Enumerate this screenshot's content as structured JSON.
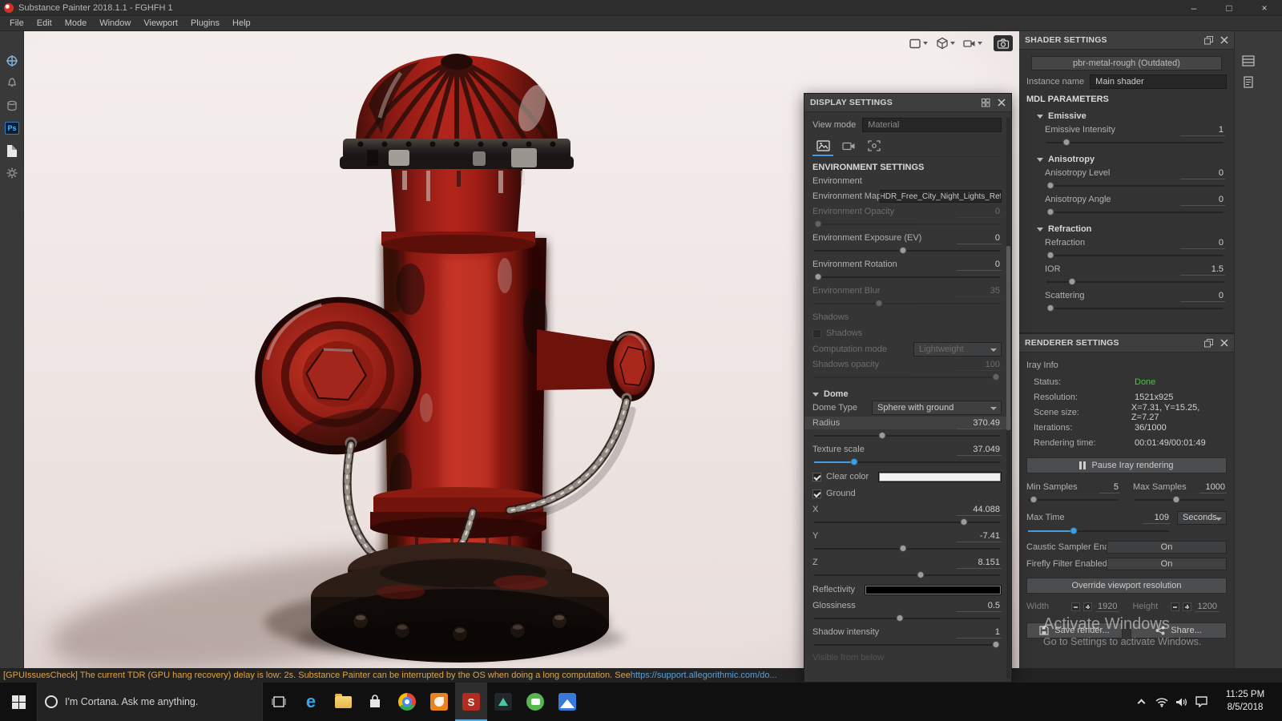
{
  "colors": {
    "accent_blue": "#3f9fdf",
    "status_done_green": "#3ecb3e",
    "warning_orange": "#dfa33d",
    "hydrant_red": "#a82017",
    "viewport_background": "#efe7e5",
    "clear_color_swatch": "#f2f2f2",
    "reflectivity_swatch": "#000000"
  },
  "icons": {
    "minimize": "–",
    "maximize": "□",
    "close": "×",
    "edge_letter": "e",
    "painter_letter": "S"
  },
  "titlebar": {
    "title": "Substance Painter 2018.1.1 - FGHFH 1"
  },
  "menubar": {
    "items": [
      "File",
      "Edit",
      "Mode",
      "Window",
      "Viewport",
      "Plugins",
      "Help"
    ]
  },
  "display_settings": {
    "title": "DISPLAY SETTINGS",
    "view_mode": {
      "label": "View mode",
      "value": "Material"
    },
    "environment_settings_header": "ENVIRONMENT SETTINGS",
    "environment_group": "Environment",
    "environment_map": {
      "label": "Environment Map",
      "value": "HDR_Free_City_Night_Lights_Ref"
    },
    "environment_opacity": {
      "label": "Environment Opacity",
      "value": "0"
    },
    "environment_exposure": {
      "label": "Environment Exposure (EV)",
      "value": "0"
    },
    "environment_rotation": {
      "label": "Environment Rotation",
      "value": "0"
    },
    "environment_blur": {
      "label": "Environment Blur",
      "value": "35"
    },
    "shadows_group": "Shadows",
    "shadows_checkbox": {
      "label": "Shadows"
    },
    "computation_mode": {
      "label": "Computation mode",
      "value": "Lightweight"
    },
    "shadows_opacity": {
      "label": "Shadows opacity",
      "value": "100"
    },
    "dome_group": "Dome",
    "dome_type": {
      "label": "Dome Type",
      "value": "Sphere with ground"
    },
    "radius": {
      "label": "Radius",
      "value": "370.49"
    },
    "texture_scale": {
      "label": "Texture scale",
      "value": "37.049"
    },
    "clear_color": {
      "label": "Clear color",
      "swatch": "#f2f2f2"
    },
    "ground": {
      "label": "Ground"
    },
    "x": {
      "label": "X",
      "value": "44.088"
    },
    "y": {
      "label": "Y",
      "value": "-7.41"
    },
    "z": {
      "label": "Z",
      "value": "8.151"
    },
    "reflectivity": {
      "label": "Reflectivity",
      "swatch": "#000000"
    },
    "glossiness": {
      "label": "Glossiness",
      "value": "0.5"
    },
    "shadow_intensity": {
      "label": "Shadow intensity",
      "value": "1"
    },
    "visible_from_below": "Visible from below"
  },
  "shader_settings": {
    "title": "SHADER SETTINGS",
    "shader_button": "pbr-metal-rough (Outdated)",
    "instance_name": {
      "label": "Instance name",
      "value": "Main shader"
    },
    "mdl_header": "MDL PARAMETERS",
    "emissive_group": "Emissive",
    "emissive_intensity": {
      "label": "Emissive Intensity",
      "value": "1"
    },
    "anisotropy_group": "Anisotropy",
    "anisotropy_level": {
      "label": "Anisotropy Level",
      "value": "0"
    },
    "anisotropy_angle": {
      "label": "Anisotropy Angle",
      "value": "0"
    },
    "refraction_group": "Refraction",
    "refraction": {
      "label": "Refraction",
      "value": "0"
    },
    "ior": {
      "label": "IOR",
      "value": "1.5"
    },
    "scattering": {
      "label": "Scattering",
      "value": "0"
    }
  },
  "renderer_settings": {
    "title": "RENDERER SETTINGS",
    "iray_info": "Iray Info",
    "status": {
      "label": "Status:",
      "value": "Done"
    },
    "resolution": {
      "label": "Resolution:",
      "value": "1521x925"
    },
    "scene_size": {
      "label": "Scene size:",
      "value": "X=7.31, Y=15.25, Z=7.27"
    },
    "iterations": {
      "label": "Iterations:",
      "value": "36/1000"
    },
    "rendering_time": {
      "label": "Rendering time:",
      "value": "00:01:49/00:01:49"
    },
    "pause_button": "Pause Iray rendering",
    "min_samples": {
      "label": "Min Samples",
      "value": "5"
    },
    "max_samples": {
      "label": "Max Samples",
      "value": "1000"
    },
    "max_time": {
      "label": "Max Time",
      "value": "109"
    },
    "seconds_dropdown": "Seconds",
    "caustic": {
      "label": "Caustic Sampler Enabled",
      "value": "On"
    },
    "firefly": {
      "label": "Firefly Filter Enabled",
      "value": "On"
    },
    "override_button": "Override viewport resolution",
    "width": {
      "label": "Width",
      "value": "1920"
    },
    "height": {
      "label": "Height",
      "value": "1200"
    },
    "save_button": "Save render...",
    "share_button": "Share..."
  },
  "activate": {
    "line1": "Activate Windows",
    "line2": "Go to Settings to activate Windows."
  },
  "statusbar": {
    "text": "[GPUIssuesCheck] The current TDR (GPU hang recovery) delay is low: 2s. Substance Painter can be interrupted by the OS when doing a long computation. See ",
    "link": "https://support.allegorithmic.com/do..."
  },
  "taskbar": {
    "cortana": "I'm Cortana. Ask me anything.",
    "clock_time": "11:25 PM",
    "clock_date": "8/5/2018"
  }
}
